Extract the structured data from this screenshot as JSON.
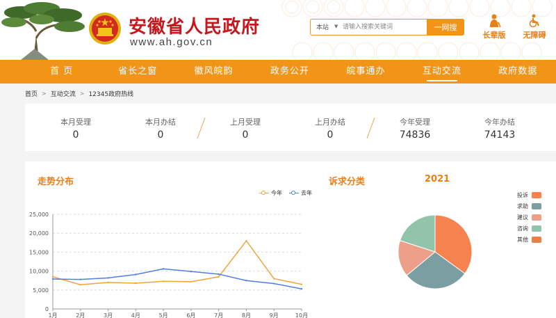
{
  "header": {
    "site_title": "安徽省人民政府",
    "site_domain": "www.ah.gov.cn",
    "search": {
      "scope": "本站",
      "placeholder": "请输入搜索关键词",
      "button_label": "一网搜"
    },
    "tools": [
      {
        "label": "长辈版",
        "icon": "elder-icon"
      },
      {
        "label": "无障碍",
        "icon": "accessibility-icon"
      }
    ]
  },
  "nav": {
    "items": [
      {
        "label": "首  页"
      },
      {
        "label": "省长之窗"
      },
      {
        "label": "徽风皖韵"
      },
      {
        "label": "政务公开"
      },
      {
        "label": "皖事通办"
      },
      {
        "label": "互动交流"
      },
      {
        "label": "政府数据"
      }
    ],
    "active": "互动交流"
  },
  "breadcrumb": {
    "items": [
      "首页",
      "互动交流",
      "12345政府热线"
    ],
    "separator": ">"
  },
  "stats": [
    {
      "label": "本月受理",
      "value": "0"
    },
    {
      "label": "本月办结",
      "value": "0"
    },
    {
      "label": "上月受理",
      "value": "0"
    },
    {
      "label": "上月办结",
      "value": "0"
    },
    {
      "label": "今年受理",
      "value": "74836"
    },
    {
      "label": "今年办结",
      "value": "74143"
    }
  ],
  "trend_panel": {
    "title": "走势分布"
  },
  "category_panel": {
    "title": "诉求分类",
    "year": "2021"
  },
  "colors": {
    "brand_orange": "#f29418",
    "brand_red": "#c8161d",
    "line_this_year": "#f3a43b",
    "line_last_year": "#4f7fe0"
  },
  "chart_data": [
    {
      "type": "line",
      "title": "走势分布",
      "x": [
        "1月",
        "2月",
        "3月",
        "4月",
        "5月",
        "6月",
        "7月",
        "8月",
        "9月",
        "10月"
      ],
      "series": [
        {
          "name": "今年",
          "color": "#f3a43b",
          "values": [
            8500,
            6400,
            7000,
            6800,
            7300,
            7200,
            8500,
            18000,
            8000,
            6500
          ]
        },
        {
          "name": "去年",
          "color": "#4f7fe0",
          "values": [
            7900,
            7800,
            8200,
            9100,
            10600,
            9900,
            9200,
            7500,
            6700,
            5300
          ]
        }
      ],
      "ylim": [
        0,
        25000
      ],
      "yticks": [
        "0",
        "5,000",
        "10,000",
        "15,000",
        "20,000",
        "25,000"
      ],
      "grid": true,
      "legend": "top-right"
    },
    {
      "type": "pie",
      "title": "2021",
      "slices": [
        {
          "label": "投诉",
          "value": 35,
          "color": "#f5824f"
        },
        {
          "label": "求助",
          "value": 29,
          "color": "#7a9ea2"
        },
        {
          "label": "建议",
          "value": 16,
          "color": "#eca08a"
        },
        {
          "label": "咨询",
          "value": 20,
          "color": "#91c4ab"
        },
        {
          "label": "其他",
          "value": 0,
          "color": "#e8804a"
        }
      ],
      "legend": "right"
    }
  ]
}
